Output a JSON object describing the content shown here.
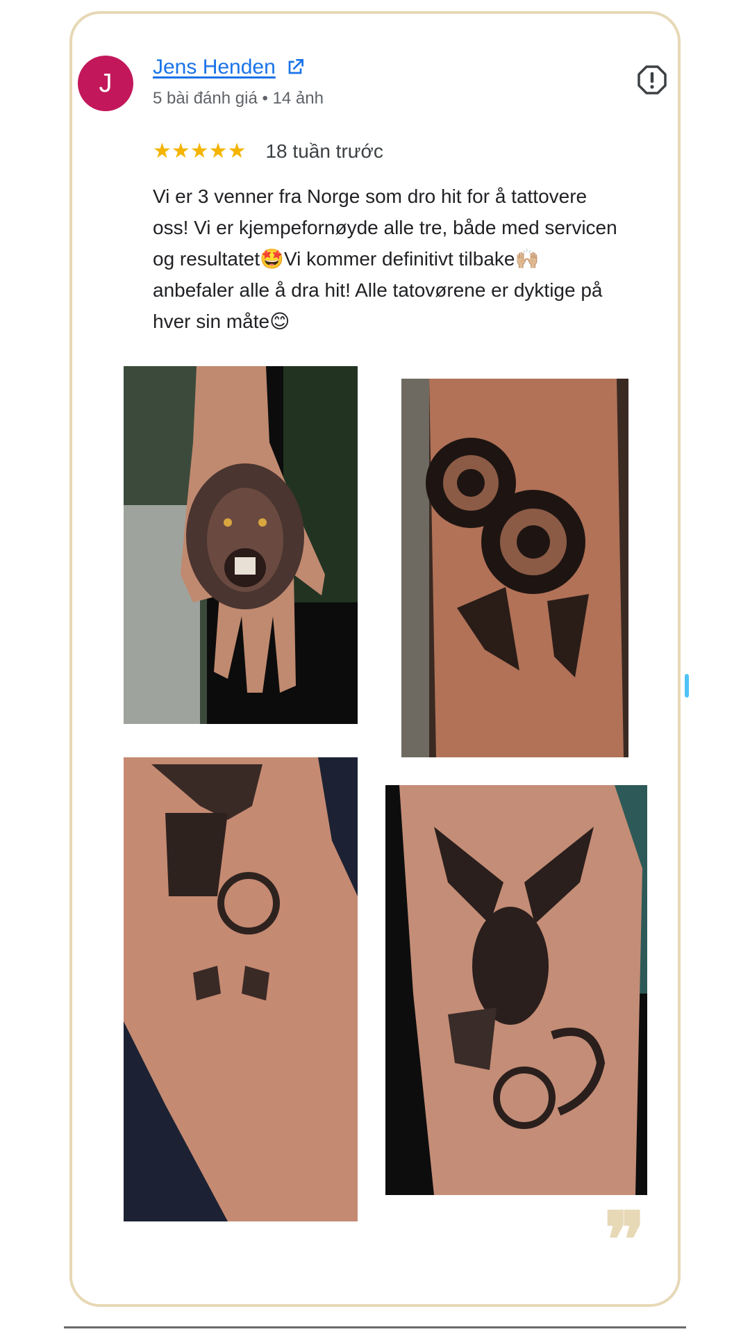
{
  "review": {
    "avatar_letter": "J",
    "reviewer_name": "Jens Henden",
    "reviewer_meta": "5 bài đánh giá • 14 ảnh",
    "rating": 5,
    "stars": "★★★★★",
    "time_ago": "18 tuần trước",
    "text": "Vi er 3 venner fra Norge som dro hit for å tattovere\noss! Vi er kjempefornøyde alle tre, både med servicen\nog resultatet🤩Vi kommer definitivt tilbake🙌🏼\nanbefaler alle å dra hit! Alle tatovørene er dyktige på\nhver sin måte😊",
    "quote_mark": "❞"
  },
  "photos": [
    {
      "name": "lion-hand-tattoo"
    },
    {
      "name": "rose-leg-tattoo"
    },
    {
      "name": "eagle-snake-arm-tattoo"
    },
    {
      "name": "eagle-snake-leg-tattoo"
    }
  ],
  "icons": {
    "external_link": "external-link-icon",
    "report": "report-icon",
    "star": "star-icon",
    "quote": "quote-icon"
  },
  "colors": {
    "card_border": "#e7d8b6",
    "avatar": "#c2185b",
    "link": "#1a73e8",
    "star": "#f4b400"
  }
}
